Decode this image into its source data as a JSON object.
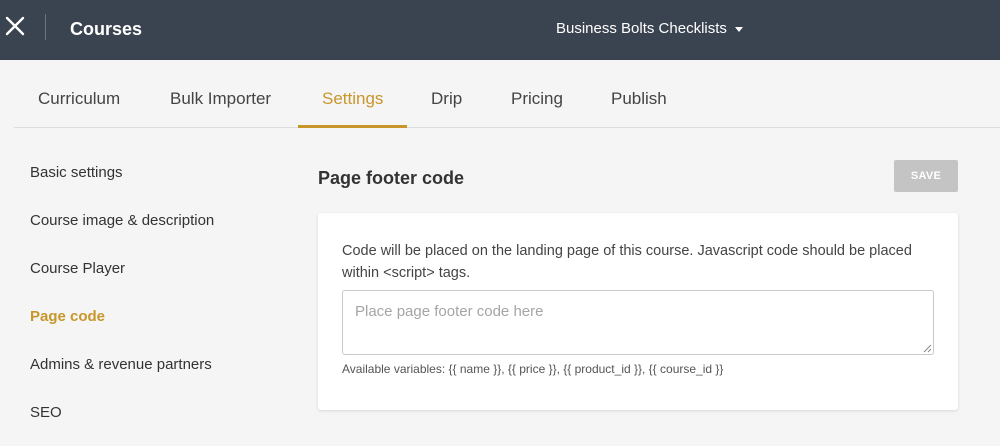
{
  "header": {
    "title": "Courses",
    "school_name": "Business Bolts Checklists",
    "close_icon": "close-icon",
    "background": "#3a4350"
  },
  "tabs": [
    {
      "label": "Curriculum",
      "active": false
    },
    {
      "label": "Bulk Importer",
      "active": false
    },
    {
      "label": "Settings",
      "active": true
    },
    {
      "label": "Drip",
      "active": false
    },
    {
      "label": "Pricing",
      "active": false
    },
    {
      "label": "Publish",
      "active": false
    }
  ],
  "sidebar": {
    "items": [
      {
        "label": "Basic settings",
        "active": false
      },
      {
        "label": "Course image & description",
        "active": false
      },
      {
        "label": "Course Player",
        "active": false
      },
      {
        "label": "Page code",
        "active": true
      },
      {
        "label": "Admins & revenue partners",
        "active": false
      },
      {
        "label": "SEO",
        "active": false
      }
    ]
  },
  "main": {
    "section_title": "Page footer code",
    "save_label": "SAVE",
    "description": "Code will be placed on the landing page of this course. Javascript code should be placed within <script> tags.",
    "code_input": {
      "value": "",
      "placeholder": "Place page footer code here"
    },
    "variables_text": "Available variables: {{ name }}, {{ price }}, {{ product_id }}, {{ course_id }}"
  },
  "colors": {
    "accent": "#c8962a",
    "save_disabled": "#c4c4c4"
  }
}
